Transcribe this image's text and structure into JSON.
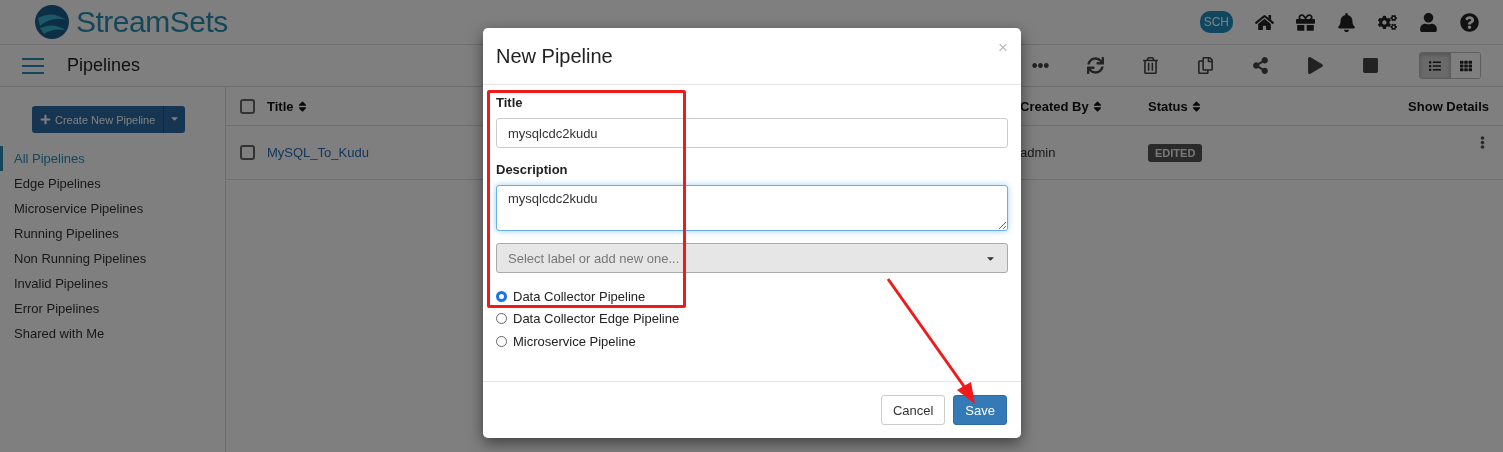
{
  "header": {
    "logo_text": "StreamSets",
    "sch_badge": "SCH"
  },
  "toolbar": {
    "title": "Pipelines",
    "view_toggle": [
      {
        "kind": "list",
        "selected": true
      },
      {
        "kind": "grid",
        "selected": false
      }
    ]
  },
  "sidebar": {
    "create_button": "Create New Pipeline",
    "items": [
      {
        "label": "All Pipelines",
        "selected": true
      },
      {
        "label": "Edge Pipelines",
        "selected": false
      },
      {
        "label": "Microservice Pipelines",
        "selected": false
      },
      {
        "label": "Running Pipelines",
        "selected": false
      },
      {
        "label": "Non Running Pipelines",
        "selected": false
      },
      {
        "label": "Invalid Pipelines",
        "selected": false
      },
      {
        "label": "Error Pipelines",
        "selected": false
      },
      {
        "label": "Shared with Me",
        "selected": false
      }
    ]
  },
  "table": {
    "select_all_checked": false,
    "columns": [
      "Title",
      "Created By",
      "Status",
      "Show Details"
    ],
    "rows": [
      {
        "checked": false,
        "title": "MySQL_To_Kudu",
        "created_by": "admin",
        "status": "EDITED"
      }
    ]
  },
  "dialog": {
    "title": "New Pipeline",
    "close": "×",
    "fields": [
      {
        "kind": "input",
        "label": "Title",
        "value": "mysqlcdc2kudu",
        "focused": false
      },
      {
        "kind": "textarea",
        "label": "Description",
        "value": "mysqlcdc2kudu",
        "focused": true
      }
    ],
    "label_select": {
      "placeholder": "Select label or add new one..."
    },
    "pipeline_types": [
      {
        "label": "Data Collector Pipeline",
        "selected": true
      },
      {
        "label": "Data Collector Edge Pipeline",
        "selected": false
      },
      {
        "label": "Microservice Pipeline",
        "selected": false
      }
    ],
    "buttons": [
      {
        "kind": "default",
        "label": "Cancel"
      },
      {
        "kind": "primary",
        "label": "Save"
      }
    ]
  }
}
